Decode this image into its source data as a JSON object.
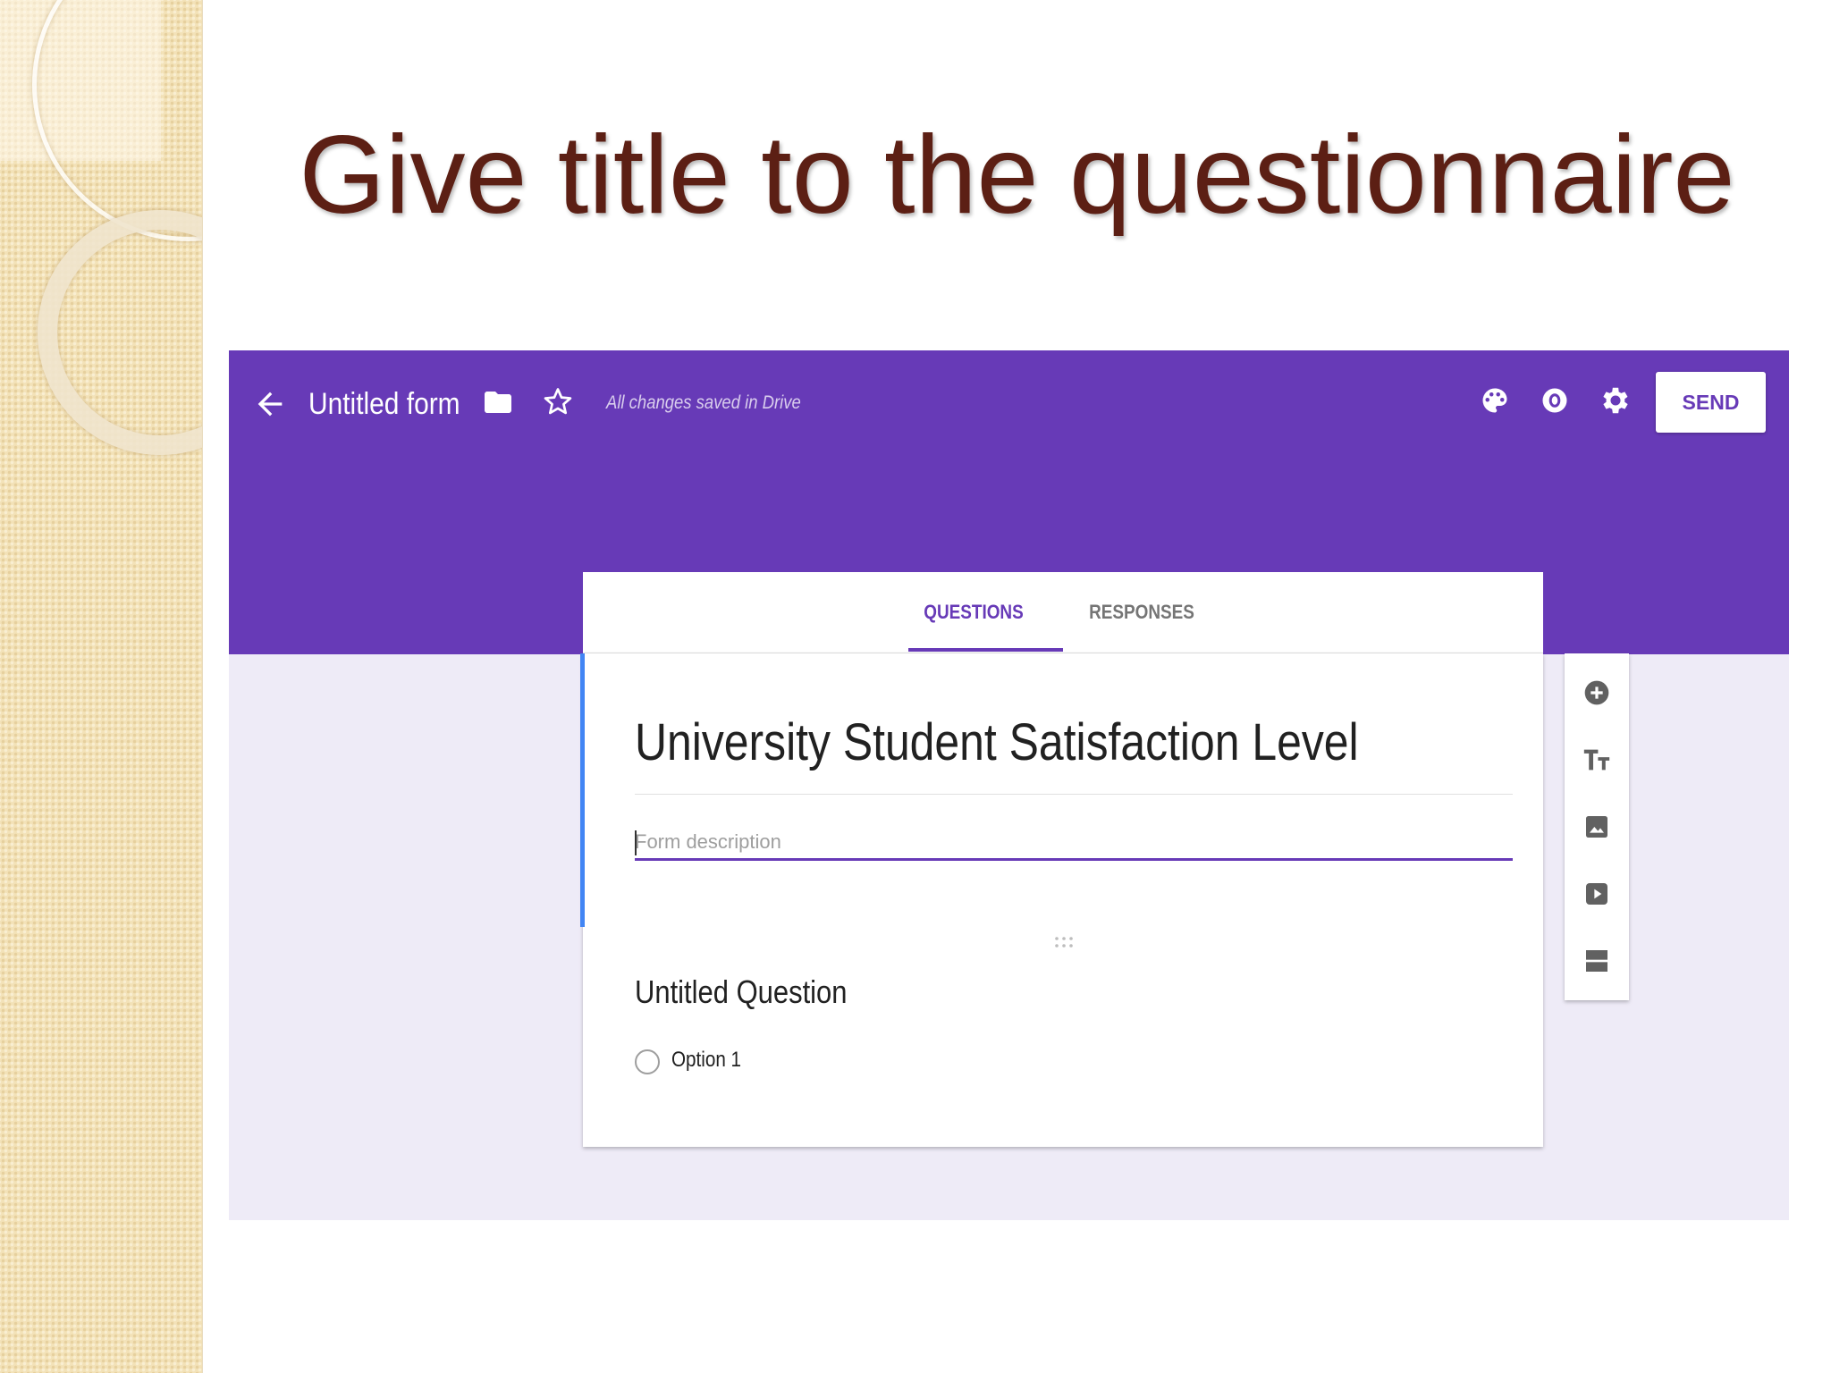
{
  "slide": {
    "title": "Give title to the questionnaire"
  },
  "topbar": {
    "form_name": "Untitled form",
    "status": "All changes saved in Drive",
    "send_label": "SEND",
    "color": "#673ab7"
  },
  "tabs": [
    {
      "label": "QUESTIONS",
      "active": true
    },
    {
      "label": "RESPONSES",
      "active": false
    }
  ],
  "form": {
    "title": "University Student Satisfaction Level",
    "description_placeholder": "Form description",
    "question": {
      "title": "Untitled Question",
      "options": [
        "Option 1"
      ]
    }
  },
  "icons": {
    "topbar": [
      "back-arrow-icon",
      "folder-icon",
      "star-icon",
      "palette-icon",
      "preview-eye-icon",
      "gear-icon"
    ],
    "side_toolbar": [
      "add-question-icon",
      "add-title-icon",
      "add-image-icon",
      "add-video-icon",
      "add-section-icon"
    ]
  }
}
